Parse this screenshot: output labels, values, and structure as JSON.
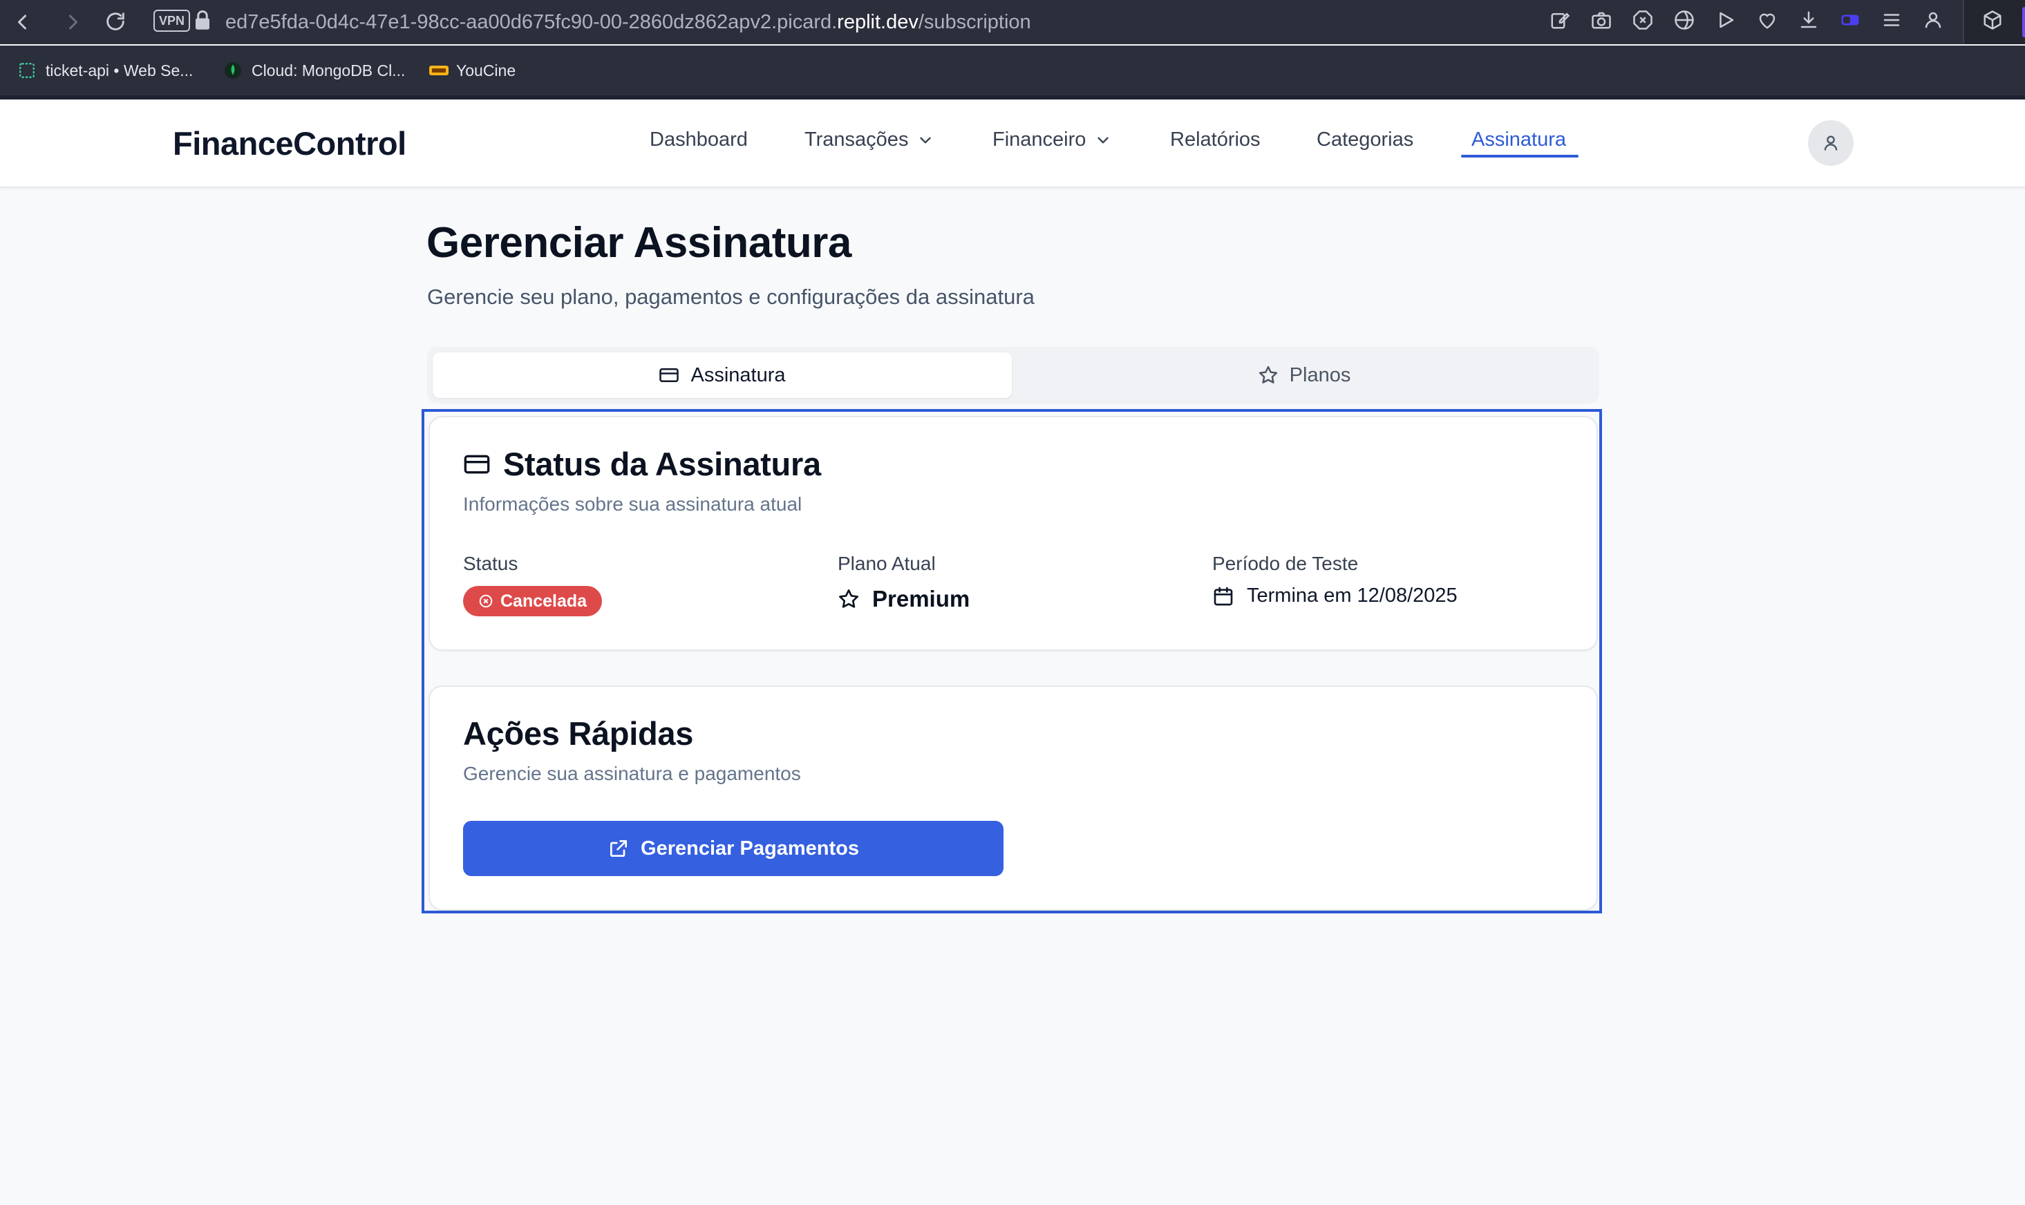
{
  "browser": {
    "url_prefix": "ed7e5fda-0d4c-47e1-98cc-aa00d675fc90-00-2860dz862apv2.picard.",
    "url_host": "replit.dev",
    "url_path": "/subscription",
    "vpn_label": "VPN",
    "bookmarks": [
      {
        "label": "ticket-api • Web Se...",
        "icon": "replit-icon"
      },
      {
        "label": "Cloud: MongoDB Cl...",
        "icon": "mongodb-leaf-icon"
      },
      {
        "label": "YouCine",
        "icon": "youcine-icon"
      }
    ]
  },
  "header": {
    "logo": "FinanceControl",
    "nav": [
      {
        "label": "Dashboard",
        "dropdown": false,
        "active": false
      },
      {
        "label": "Transações",
        "dropdown": true,
        "active": false
      },
      {
        "label": "Financeiro",
        "dropdown": true,
        "active": false
      },
      {
        "label": "Relatórios",
        "dropdown": false,
        "active": false
      },
      {
        "label": "Categorias",
        "dropdown": false,
        "active": false
      },
      {
        "label": "Assinatura",
        "dropdown": false,
        "active": true
      }
    ],
    "accent_color": "#2d5bd6"
  },
  "page": {
    "title": "Gerenciar Assinatura",
    "subtitle": "Gerencie seu plano, pagamentos e configurações da assinatura",
    "tabs": [
      {
        "label": "Assinatura",
        "icon": "credit-card-icon",
        "active": true
      },
      {
        "label": "Planos",
        "icon": "star-icon",
        "active": false
      }
    ]
  },
  "status_card": {
    "title": "Status da Assinatura",
    "description": "Informações sobre sua assinatura atual",
    "status_label": "Status",
    "status_value": "Cancelada",
    "status_color": "#de4a4a",
    "plan_label": "Plano Atual",
    "plan_value": "Premium",
    "trial_label": "Período de Teste",
    "trial_value": "Termina em 12/08/2025"
  },
  "actions_card": {
    "title": "Ações Rápidas",
    "description": "Gerencie sua assinatura e pagamentos",
    "button_label": "Gerenciar Pagamentos",
    "button_color": "#3560e0"
  }
}
